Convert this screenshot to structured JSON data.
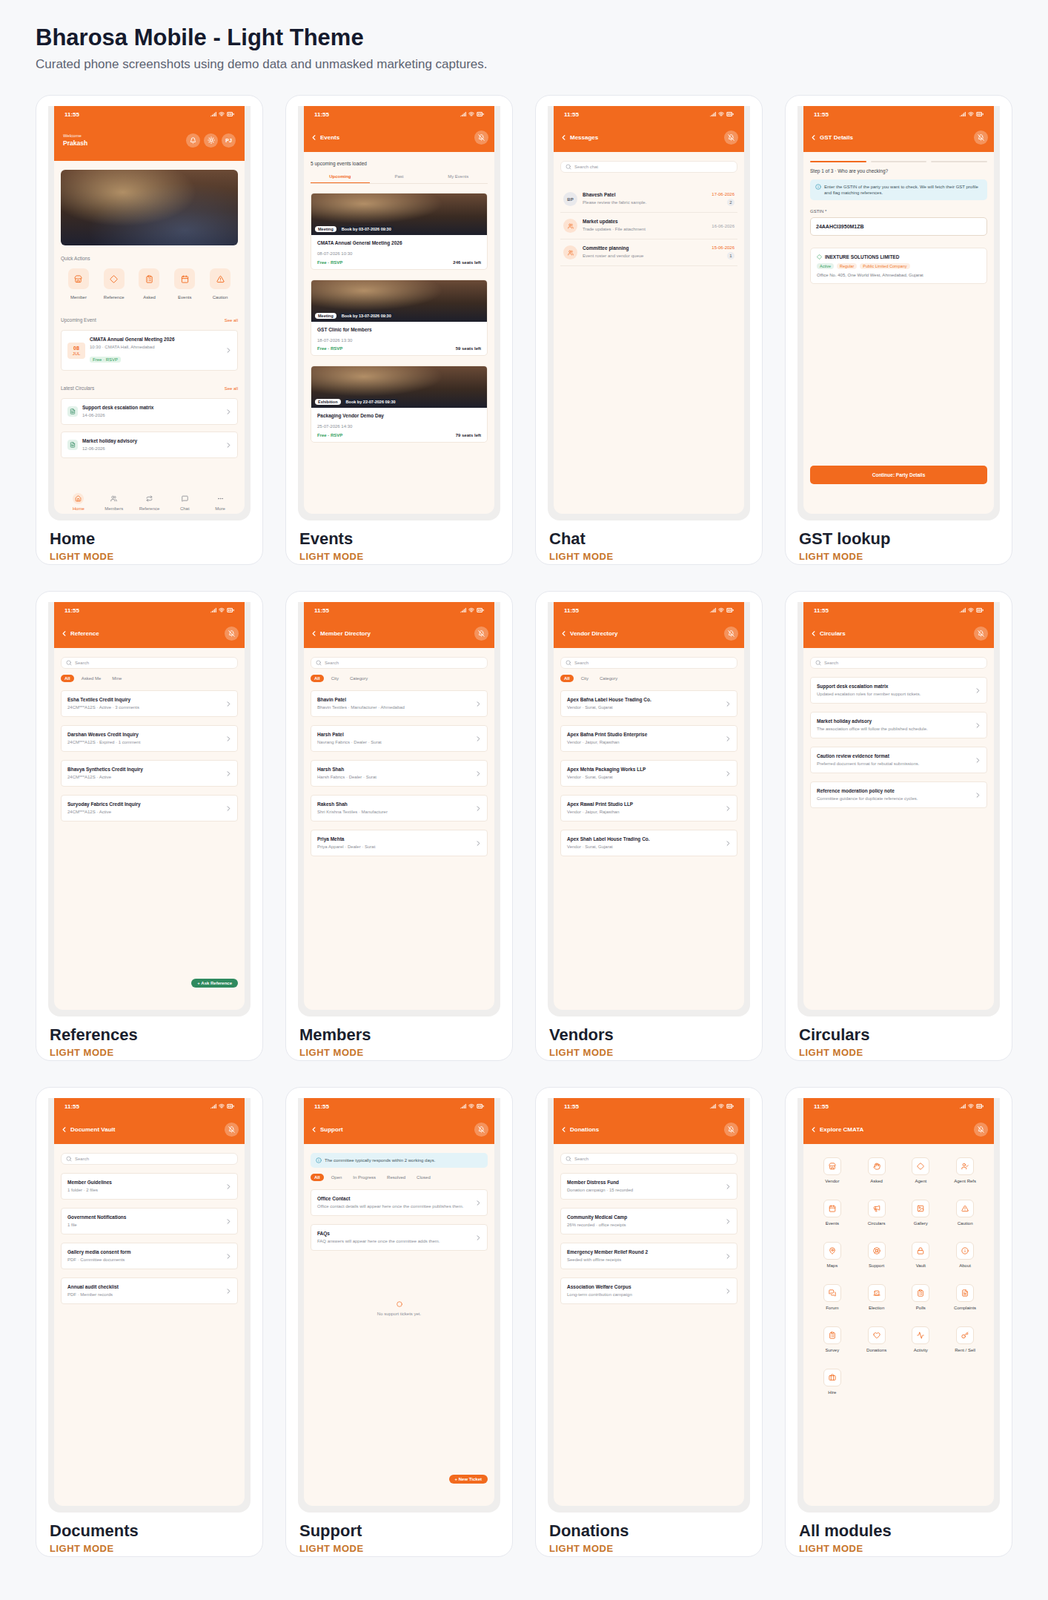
{
  "page": {
    "title": "Bharosa Mobile - Light Theme",
    "subtitle": "Curated phone screenshots using demo data and unmasked marketing captures."
  },
  "screens": [
    {
      "kind": "home",
      "caption": "Home",
      "mode": "LIGHT MODE",
      "time": "11:55",
      "greeting": "Welcome",
      "user": "Prakash",
      "avatar": "PJ",
      "quick_actions_title": "Quick Actions",
      "quick_actions": [
        "Member",
        "Reference",
        "Asked",
        "Events",
        "Caution"
      ],
      "upcoming_title": "Upcoming Event",
      "upcoming_link": "See all",
      "event": {
        "day": "08",
        "month": "JUL",
        "title": "CMATA Annual General Meeting 2026",
        "meta": "10:30 · CMATA Hall, Ahmedabad",
        "tag": "Free · RSVP"
      },
      "circulars_title": "Latest Circulars",
      "circulars_link": "See all",
      "circulars": [
        {
          "title": "Support desk escalation matrix",
          "date": "14-06-2026"
        },
        {
          "title": "Market holiday advisory",
          "date": "12-06-2026"
        }
      ],
      "nav": [
        {
          "label": "Home",
          "selected": true
        },
        {
          "label": "Members",
          "selected": false
        },
        {
          "label": "Reference",
          "selected": false
        },
        {
          "label": "Chat",
          "selected": false
        },
        {
          "label": "More",
          "selected": false
        }
      ]
    },
    {
      "kind": "events",
      "caption": "Events",
      "mode": "LIGHT MODE",
      "time": "11:55",
      "title": "Events",
      "status": "5 upcoming events loaded",
      "tabs": [
        {
          "label": "Upcoming",
          "selected": true
        },
        {
          "label": "Past",
          "selected": false
        },
        {
          "label": "My Events",
          "selected": false
        }
      ],
      "events": [
        {
          "type": "Meeting",
          "deadline": "Book by 03-07-2026 09:30",
          "title": "CMATA Annual General Meeting 2026",
          "date": "08-07-2026 10:30",
          "price": "Free · RSVP",
          "seats": "246 seats left"
        },
        {
          "type": "Meeting",
          "deadline": "Book by 13-07-2026 09:30",
          "title": "GST Clinic for Members",
          "date": "18-07-2026 13:30",
          "price": "Free · RSVP",
          "seats": "59 seats left"
        },
        {
          "type": "Exhibition",
          "deadline": "Book by 22-07-2026 09:30",
          "title": "Packaging Vendor Demo Day",
          "date": "25-07-2026 14:30",
          "price": "Free · RSVP",
          "seats": "79 seats left"
        }
      ]
    },
    {
      "kind": "chat",
      "caption": "Chat",
      "mode": "LIGHT MODE",
      "time": "11:55",
      "title": "Messages",
      "search": "Search chat",
      "chats": [
        {
          "kind": "initials",
          "avatar": "BP",
          "name": "Bhavesh Patel",
          "preview": "Please review the fabric sample.",
          "date": "17-06-2026",
          "unread": "2"
        },
        {
          "kind": "group",
          "avatar": "",
          "name": "Market updates",
          "preview": "Trade updates · File attachment",
          "date": "16-06-2026",
          "unread": ""
        },
        {
          "kind": "group",
          "avatar": "",
          "name": "Committee planning",
          "preview": "Event roster and vendor queue",
          "date": "15-06-2026",
          "unread": "1"
        }
      ]
    },
    {
      "kind": "gst",
      "caption": "GST lookup",
      "mode": "LIGHT MODE",
      "time": "11:55",
      "title": "GST Details",
      "steps": [
        {
          "active": true
        },
        {
          "active": false
        },
        {
          "active": false
        }
      ],
      "step_label": "Step 1 of 3 · Who are you checking?",
      "info": "Enter the GSTIN of the party you want to check. We will fetch their GST profile and flag matching references.",
      "field_label": "GSTIN *",
      "field_value": "24AAHCI3950M1ZB",
      "result": {
        "name": "INEXTURE SOLUTIONS LIMITED",
        "tags": [
          {
            "label": "Active",
            "color": "#2f9e5b"
          },
          {
            "label": "Regular",
            "color": "#f0792b"
          },
          {
            "label": "Public Limited Company",
            "color": "#f0792b"
          }
        ],
        "address": "Office No. 405, One World West, Ahmedabad, Gujarat"
      },
      "button": "Continue: Party Details"
    },
    {
      "kind": "list",
      "caption": "References",
      "mode": "LIGHT MODE",
      "time": "11:55",
      "title": "Reference",
      "search": "Search",
      "chips": [
        {
          "label": "All",
          "selected": true
        },
        {
          "label": "Asked Me",
          "selected": false
        },
        {
          "label": "Mine",
          "selected": false
        }
      ],
      "items": [
        {
          "title": "Esha Textiles Credit Inquiry",
          "subtitle": "24CM***A12S · Active · 3 comments"
        },
        {
          "title": "Darshan Weaves Credit Inquiry",
          "subtitle": "24CM***A12S · Expired · 1 comment"
        },
        {
          "title": "Bhavya Synthetics Credit Inquiry",
          "subtitle": "24CM***A12S · Active"
        },
        {
          "title": "Suryoday Fabrics Credit Inquiry",
          "subtitle": "24CM***A12S · Active"
        }
      ],
      "fab": {
        "label": "+ Ask Reference",
        "color": "#2f8a5f"
      }
    },
    {
      "kind": "list",
      "caption": "Members",
      "mode": "LIGHT MODE",
      "time": "11:55",
      "title": "Member Directory",
      "search": "Search",
      "chips": [
        {
          "label": "All",
          "selected": true
        },
        {
          "label": "City",
          "selected": false
        },
        {
          "label": "Category",
          "selected": false
        }
      ],
      "items": [
        {
          "title": "Bhavin Patel",
          "subtitle": "Bhavin Textiles · Manufacturer · Ahmedabad"
        },
        {
          "title": "Harsh Patel",
          "subtitle": "Navrang Fabrics · Dealer · Surat"
        },
        {
          "title": "Harsh Shah",
          "subtitle": "Harsh Fabrics · Dealer · Surat"
        },
        {
          "title": "Rakesh Shah",
          "subtitle": "Shri Krishna Textiles · Manufacturer"
        },
        {
          "title": "Priya Mehta",
          "subtitle": "Priya Apparel · Dealer · Surat"
        }
      ]
    },
    {
      "kind": "list",
      "caption": "Vendors",
      "mode": "LIGHT MODE",
      "time": "11:55",
      "title": "Vendor Directory",
      "search": "Search",
      "chips": [
        {
          "label": "All",
          "selected": true
        },
        {
          "label": "City",
          "selected": false
        },
        {
          "label": "Category",
          "selected": false
        }
      ],
      "items": [
        {
          "title": "Apex Bafna Label House Trading Co.",
          "subtitle": "Vendor · Surat, Gujarat"
        },
        {
          "title": "Apex Bafna Print Studio Enterprise",
          "subtitle": "Vendor · Jaipur, Rajasthan"
        },
        {
          "title": "Apex Mehta Packaging Works LLP",
          "subtitle": "Vendor · Surat, Gujarat"
        },
        {
          "title": "Apex Rawal Print Studio LLP",
          "subtitle": "Vendor · Jaipur, Rajasthan"
        },
        {
          "title": "Apex Shah Label House Trading Co.",
          "subtitle": "Vendor · Surat, Gujarat"
        }
      ]
    },
    {
      "kind": "list",
      "caption": "Circulars",
      "mode": "LIGHT MODE",
      "time": "11:55",
      "title": "Circulars",
      "search": "Search",
      "items": [
        {
          "title": "Support desk escalation matrix",
          "subtitle": "Updated escalation roles for member support tickets."
        },
        {
          "title": "Market holiday advisory",
          "subtitle": "The association office will follow the published schedule."
        },
        {
          "title": "Caution review evidence format",
          "subtitle": "Preferred document format for rebuttal submissions."
        },
        {
          "title": "Reference moderation policy note",
          "subtitle": "Committee guidance for duplicate reference cycles."
        }
      ]
    },
    {
      "kind": "list",
      "caption": "Documents",
      "mode": "LIGHT MODE",
      "time": "11:55",
      "title": "Document Vault",
      "search": "Search",
      "items": [
        {
          "title": "Member Guidelines",
          "subtitle": "1 folder · 2 files"
        },
        {
          "title": "Government Notifications",
          "subtitle": "1 file"
        },
        {
          "title": "Gallery media consent form",
          "subtitle": "PDF · Committee documents"
        },
        {
          "title": "Annual audit checklist",
          "subtitle": "PDF · Member records"
        }
      ]
    },
    {
      "kind": "support",
      "caption": "Support",
      "mode": "LIGHT MODE",
      "time": "11:55",
      "title": "Support",
      "info": "The committee typically responds within 2 working days.",
      "chips": [
        {
          "label": "All",
          "selected": true
        },
        {
          "label": "Open",
          "selected": false
        },
        {
          "label": "In Progress",
          "selected": false
        },
        {
          "label": "Resolved",
          "selected": false
        },
        {
          "label": "Closed",
          "selected": false
        }
      ],
      "items": [
        {
          "title": "Office Contact",
          "subtitle": "Office contact details will appear here once the committee publishes them."
        },
        {
          "title": "FAQs",
          "subtitle": "FAQ answers will appear here once the committee adds them."
        }
      ],
      "empty": "No support tickets yet.",
      "fab": {
        "label": "+ New Ticket",
        "color": "#f26a1e"
      }
    },
    {
      "kind": "list",
      "caption": "Donations",
      "mode": "LIGHT MODE",
      "time": "11:55",
      "title": "Donations",
      "search": "Search",
      "items": [
        {
          "title": "Member Distress Fund",
          "subtitle": "Donation campaign · 15 recorded"
        },
        {
          "title": "Community Medical Camp",
          "subtitle": "26% recorded · office receipts"
        },
        {
          "title": "Emergency Member Relief Round 2",
          "subtitle": "Seeded with offline receipts"
        },
        {
          "title": "Association Welfare Corpus",
          "subtitle": "Long-term contribution campaign"
        }
      ]
    },
    {
      "kind": "modules",
      "caption": "All modules",
      "mode": "LIGHT MODE",
      "time": "11:55",
      "title": "Explore CMATA",
      "modules": [
        "Vendor",
        "Asked",
        "Agent",
        "Agent Refs",
        "Events",
        "Circulars",
        "Gallery",
        "Caution",
        "Maps",
        "Support",
        "Vault",
        "About",
        "Forum",
        "Election",
        "Polls",
        "Complaints",
        "Survey",
        "Donations",
        "Activity",
        "Rent / Sell",
        "Hire"
      ]
    }
  ]
}
